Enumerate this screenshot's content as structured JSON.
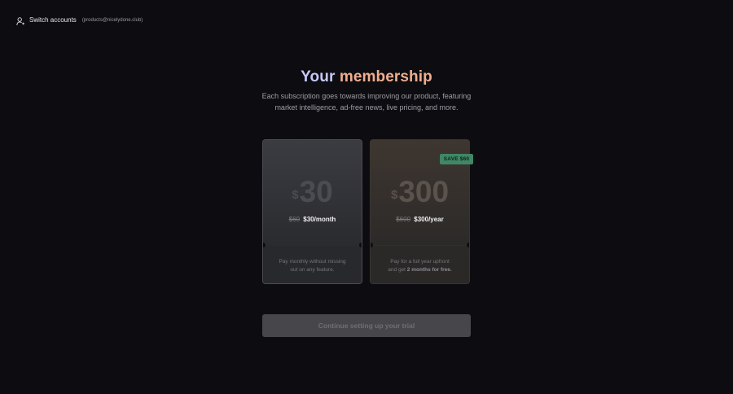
{
  "account": {
    "switch_label": "Switch accounts",
    "email": "(products@nicelydone.club)",
    "icon": "user-switch-icon"
  },
  "header": {
    "title_part1": "Your",
    "title_part2": "membership",
    "subtitle_line1": "Each subscription goes towards improving our product, featuring",
    "subtitle_line2": "market intelligence, ad-free news, live pricing, and more."
  },
  "plans": [
    {
      "currency": "$",
      "amount": "30",
      "old_price": "$60",
      "new_price": "$30/month",
      "desc_line1": "Pay monthly without missing",
      "desc_line2": "out on any feature."
    },
    {
      "currency": "$",
      "amount": "300",
      "old_price": "$600",
      "new_price": "$300/year",
      "desc_line1": "Pay for a full year upfront",
      "desc_line2_prefix": "and get ",
      "desc_line2_bold": "2 months for free.",
      "badge": "SAVE $60"
    }
  ],
  "cta": {
    "label": "Continue setting up your trial"
  },
  "colors": {
    "background": "#0d0d11",
    "title_first_word": "#c6c8f6",
    "title_second_word": "#f0ae8e",
    "badge": "#3f8765"
  }
}
